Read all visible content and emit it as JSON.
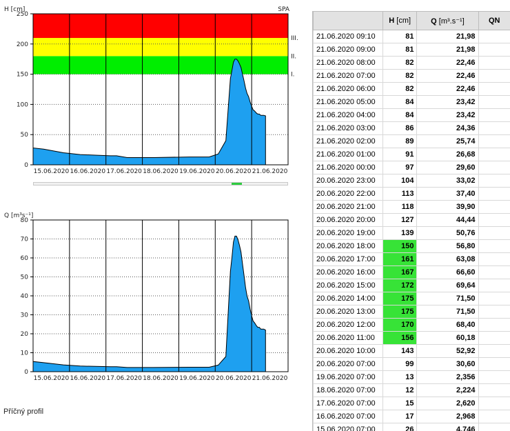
{
  "chart_data": [
    {
      "type": "area",
      "title": "H",
      "ylabel": "H [cm]",
      "ylim": [
        0,
        250
      ],
      "yticks": [
        0,
        50,
        100,
        150,
        200,
        250
      ],
      "x_start": "15.06.2020 00:00",
      "x_end": "22.06.2020 00:00",
      "xtick_labels": [
        "15.06.2020",
        "16.06.2020",
        "17.06.2020",
        "18.06.2020",
        "19.06.2020",
        "20.06.2020",
        "21.06.2020"
      ],
      "corner_label": "SPA",
      "bands": [
        {
          "name": "I.",
          "from": 150,
          "to": 180,
          "color": "#00ee00"
        },
        {
          "name": "II.",
          "from": 180,
          "to": 210,
          "color": "#ffff00"
        },
        {
          "name": "III.",
          "from": 210,
          "to": 250,
          "color": "#ff0000"
        }
      ],
      "fill_color": "#1ea0f0",
      "series": [
        {
          "x": [
            "15.06.2020 00:00",
            "15.06.2020 07:00",
            "15.06.2020 20:00",
            "16.06.2020 07:00",
            "16.06.2020 17:00",
            "17.06.2020 03:00",
            "17.06.2020 07:00",
            "17.06.2020 14:00",
            "18.06.2020 00:00",
            "18.06.2020 07:00",
            "19.06.2020 07:00",
            "19.06.2020 20:00",
            "20.06.2020 02:00",
            "20.06.2020 07:00",
            "20.06.2020 10:00",
            "20.06.2020 11:00",
            "20.06.2020 12:00",
            "20.06.2020 13:00",
            "20.06.2020 14:00",
            "20.06.2020 15:00",
            "20.06.2020 16:00",
            "20.06.2020 17:00",
            "20.06.2020 18:00",
            "20.06.2020 19:00",
            "20.06.2020 20:00",
            "20.06.2020 21:00",
            "20.06.2020 22:00",
            "20.06.2020 23:00",
            "21.06.2020 00:00",
            "21.06.2020 01:00",
            "21.06.2020 02:00",
            "21.06.2020 03:00",
            "21.06.2020 04:00",
            "21.06.2020 05:00",
            "21.06.2020 06:00",
            "21.06.2020 07:00",
            "21.06.2020 08:00",
            "21.06.2020 09:00",
            "21.06.2020 09:10"
          ],
          "values": [
            28,
            26,
            20,
            17,
            16,
            15,
            15,
            12,
            12,
            12,
            13,
            13,
            18,
            40,
            143,
            156,
            170,
            175,
            175,
            172,
            167,
            161,
            150,
            139,
            127,
            118,
            113,
            104,
            97,
            91,
            89,
            86,
            84,
            84,
            82,
            82,
            82,
            81,
            81
          ]
        }
      ]
    },
    {
      "type": "area",
      "title": "Q",
      "ylabel": "Q [m³s⁻¹]",
      "ylim": [
        0,
        80
      ],
      "yticks": [
        0,
        10,
        20,
        30,
        40,
        50,
        60,
        70,
        80
      ],
      "x_start": "15.06.2020 00:00",
      "x_end": "22.06.2020 00:00",
      "xtick_labels": [
        "15.06.2020",
        "16.06.2020",
        "17.06.2020",
        "18.06.2020",
        "19.06.2020",
        "20.06.2020",
        "21.06.2020"
      ],
      "fill_color": "#1ea0f0",
      "series": [
        {
          "x": [
            "15.06.2020 00:00",
            "15.06.2020 07:00",
            "15.06.2020 20:00",
            "16.06.2020 07:00",
            "16.06.2020 17:00",
            "17.06.2020 03:00",
            "17.06.2020 07:00",
            "17.06.2020 14:00",
            "18.06.2020 00:00",
            "18.06.2020 07:00",
            "19.06.2020 07:00",
            "19.06.2020 20:00",
            "20.06.2020 02:00",
            "20.06.2020 07:00",
            "20.06.2020 10:00",
            "20.06.2020 11:00",
            "20.06.2020 12:00",
            "20.06.2020 13:00",
            "20.06.2020 14:00",
            "20.06.2020 15:00",
            "20.06.2020 16:00",
            "20.06.2020 17:00",
            "20.06.2020 18:00",
            "20.06.2020 19:00",
            "20.06.2020 20:00",
            "20.06.2020 21:00",
            "20.06.2020 22:00",
            "20.06.2020 23:00",
            "21.06.2020 00:00",
            "21.06.2020 01:00",
            "21.06.2020 02:00",
            "21.06.2020 03:00",
            "21.06.2020 04:00",
            "21.06.2020 05:00",
            "21.06.2020 06:00",
            "21.06.2020 07:00",
            "21.06.2020 08:00",
            "21.06.2020 09:00",
            "21.06.2020 09:10"
          ],
          "values": [
            5.4,
            4.746,
            3.6,
            2.968,
            2.8,
            2.62,
            2.62,
            2.224,
            2.224,
            2.224,
            2.356,
            2.356,
            3.5,
            8.0,
            52.92,
            60.18,
            68.4,
            71.5,
            71.5,
            69.64,
            66.6,
            63.08,
            56.8,
            50.76,
            44.44,
            39.9,
            37.4,
            33.02,
            29.6,
            26.68,
            25.74,
            24.36,
            23.42,
            23.42,
            22.46,
            22.46,
            22.46,
            21.98,
            21.98
          ]
        }
      ]
    },
    {
      "type": "table",
      "headers": {
        "dt": "",
        "h": "H",
        "h_unit": "[cm]",
        "q": "Q",
        "q_unit": "[m³.s⁻¹]",
        "qn": "QN"
      },
      "alert_color": "#37e337",
      "rows": [
        {
          "dt": "21.06.2020 09:10",
          "h": "81",
          "q": "21,98",
          "alert": false
        },
        {
          "dt": "21.06.2020 09:00",
          "h": "81",
          "q": "21,98",
          "alert": false
        },
        {
          "dt": "21.06.2020 08:00",
          "h": "82",
          "q": "22,46",
          "alert": false
        },
        {
          "dt": "21.06.2020 07:00",
          "h": "82",
          "q": "22,46",
          "alert": false
        },
        {
          "dt": "21.06.2020 06:00",
          "h": "82",
          "q": "22,46",
          "alert": false
        },
        {
          "dt": "21.06.2020 05:00",
          "h": "84",
          "q": "23,42",
          "alert": false
        },
        {
          "dt": "21.06.2020 04:00",
          "h": "84",
          "q": "23,42",
          "alert": false
        },
        {
          "dt": "21.06.2020 03:00",
          "h": "86",
          "q": "24,36",
          "alert": false
        },
        {
          "dt": "21.06.2020 02:00",
          "h": "89",
          "q": "25,74",
          "alert": false
        },
        {
          "dt": "21.06.2020 01:00",
          "h": "91",
          "q": "26,68",
          "alert": false
        },
        {
          "dt": "21.06.2020 00:00",
          "h": "97",
          "q": "29,60",
          "alert": false
        },
        {
          "dt": "20.06.2020 23:00",
          "h": "104",
          "q": "33,02",
          "alert": false
        },
        {
          "dt": "20.06.2020 22:00",
          "h": "113",
          "q": "37,40",
          "alert": false
        },
        {
          "dt": "20.06.2020 21:00",
          "h": "118",
          "q": "39,90",
          "alert": false
        },
        {
          "dt": "20.06.2020 20:00",
          "h": "127",
          "q": "44,44",
          "alert": false
        },
        {
          "dt": "20.06.2020 19:00",
          "h": "139",
          "q": "50,76",
          "alert": false
        },
        {
          "dt": "20.06.2020 18:00",
          "h": "150",
          "q": "56,80",
          "alert": true
        },
        {
          "dt": "20.06.2020 17:00",
          "h": "161",
          "q": "63,08",
          "alert": true
        },
        {
          "dt": "20.06.2020 16:00",
          "h": "167",
          "q": "66,60",
          "alert": true
        },
        {
          "dt": "20.06.2020 15:00",
          "h": "172",
          "q": "69,64",
          "alert": true
        },
        {
          "dt": "20.06.2020 14:00",
          "h": "175",
          "q": "71,50",
          "alert": true
        },
        {
          "dt": "20.06.2020 13:00",
          "h": "175",
          "q": "71,50",
          "alert": true
        },
        {
          "dt": "20.06.2020 12:00",
          "h": "170",
          "q": "68,40",
          "alert": true
        },
        {
          "dt": "20.06.2020 11:00",
          "h": "156",
          "q": "60,18",
          "alert": true
        },
        {
          "dt": "20.06.2020 10:00",
          "h": "143",
          "q": "52,92",
          "alert": false
        },
        {
          "dt": "20.06.2020 07:00",
          "h": "99",
          "q": "30,60",
          "alert": false
        },
        {
          "dt": "19.06.2020 07:00",
          "h": "13",
          "q": "2,356",
          "alert": false
        },
        {
          "dt": "18.06.2020 07:00",
          "h": "12",
          "q": "2,224",
          "alert": false
        },
        {
          "dt": "17.06.2020 07:00",
          "h": "15",
          "q": "2,620",
          "alert": false
        },
        {
          "dt": "16.06.2020 07:00",
          "h": "17",
          "q": "2,968",
          "alert": false
        },
        {
          "dt": "15.06.2020 07:00",
          "h": "26",
          "q": "4,746",
          "alert": false
        }
      ]
    }
  ],
  "scrollbar": {
    "thumb_start": 0.78,
    "thumb_end": 0.82,
    "color": "#2ecc40"
  },
  "profile_link": "Příčný profil"
}
